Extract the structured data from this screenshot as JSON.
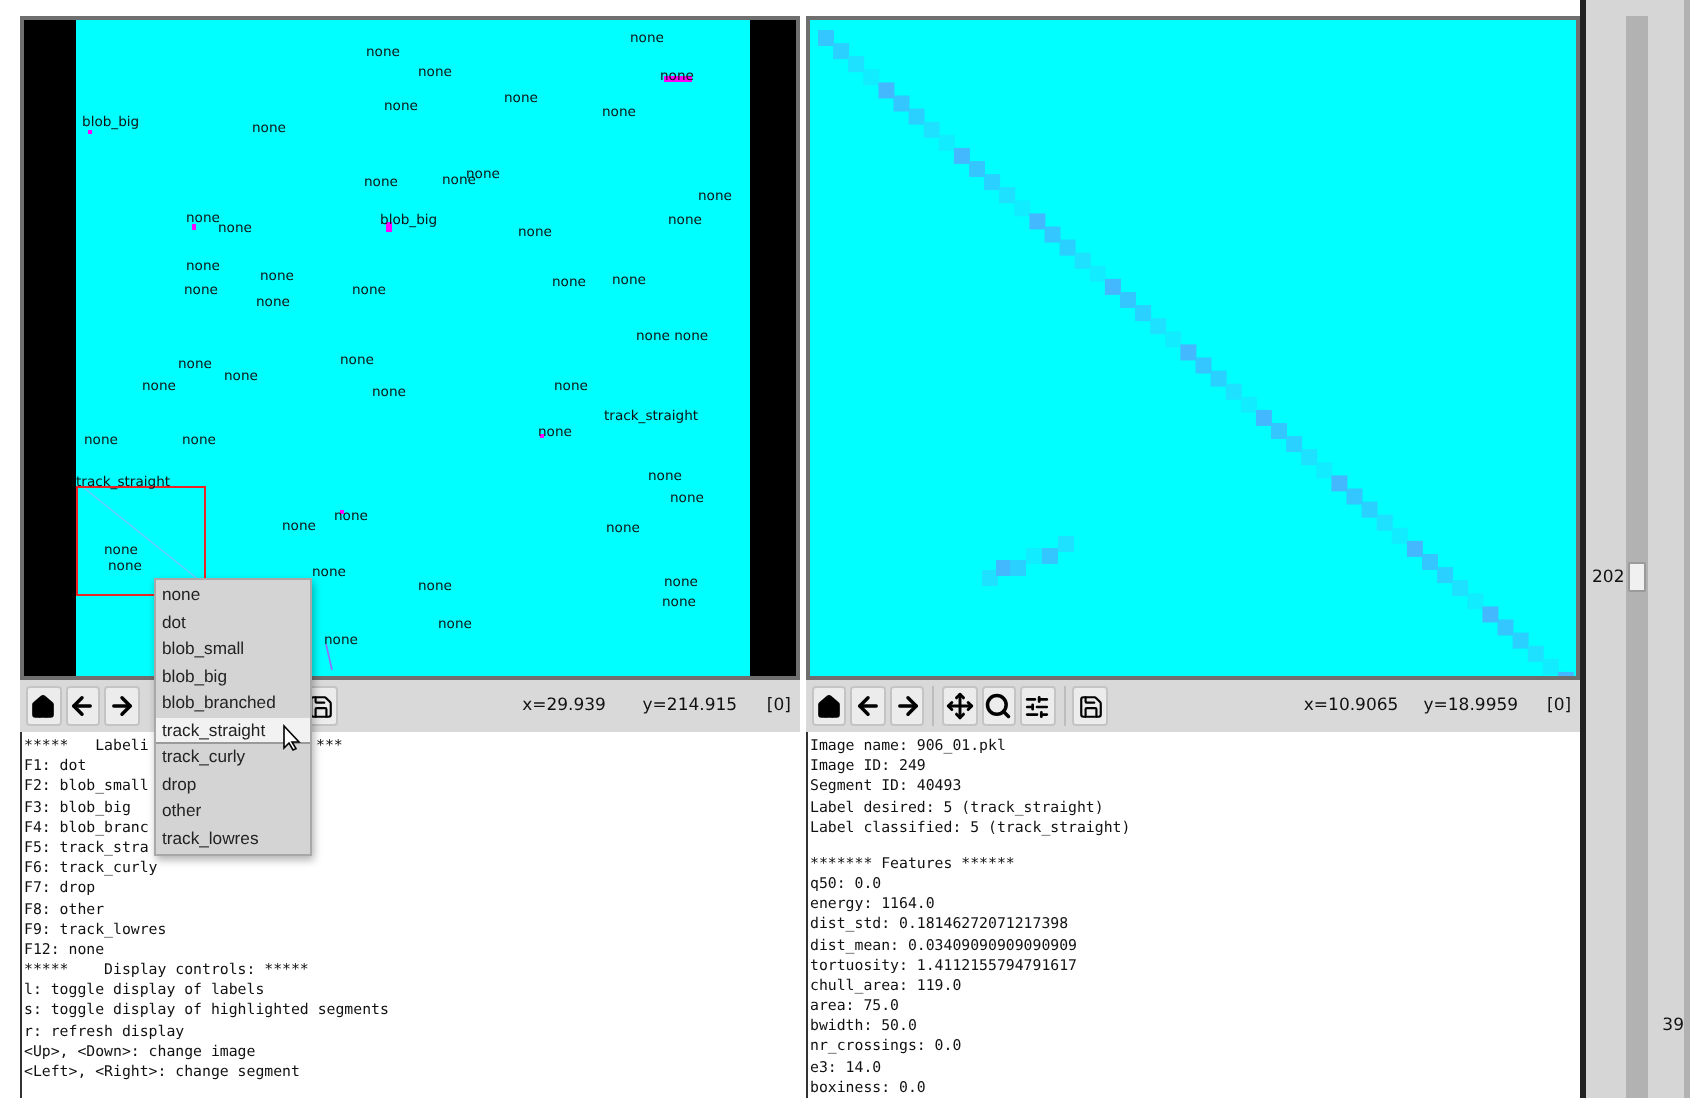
{
  "left_panel": {
    "labels": [
      {
        "text": "none"
      },
      {
        "text": "none"
      },
      {
        "text": "none"
      },
      {
        "text": "none"
      },
      {
        "text": "none"
      },
      {
        "text": "none"
      },
      {
        "text": "none"
      },
      {
        "text": "blob_big"
      },
      {
        "text": "none"
      },
      {
        "text": "none"
      },
      {
        "text": "none"
      },
      {
        "text": "none"
      },
      {
        "text": "none"
      },
      {
        "text": "none"
      },
      {
        "text": "none"
      },
      {
        "text": "blob_big"
      },
      {
        "text": "none"
      },
      {
        "text": "none"
      },
      {
        "text": "none"
      },
      {
        "text": "none"
      },
      {
        "text": "none"
      },
      {
        "text": "none"
      },
      {
        "text": "none"
      },
      {
        "text": "none"
      },
      {
        "text": "none"
      },
      {
        "text": "none none"
      },
      {
        "text": "none"
      },
      {
        "text": "none"
      },
      {
        "text": "none"
      },
      {
        "text": "none"
      },
      {
        "text": "none"
      },
      {
        "text": "none"
      },
      {
        "text": "track_straight"
      },
      {
        "text": "none"
      },
      {
        "text": "none"
      },
      {
        "text": "none"
      },
      {
        "text": "track_straight"
      },
      {
        "text": "none"
      },
      {
        "text": "none"
      },
      {
        "text": "none"
      },
      {
        "text": "none"
      },
      {
        "text": "none"
      },
      {
        "text": "none"
      },
      {
        "text": "none"
      },
      {
        "text": "none"
      },
      {
        "text": "none"
      },
      {
        "text": "none"
      },
      {
        "text": "none"
      },
      {
        "text": "none"
      },
      {
        "text": "none"
      }
    ],
    "menu": {
      "items": [
        {
          "label": "none",
          "selected": false
        },
        {
          "label": "dot",
          "selected": false
        },
        {
          "label": "blob_small",
          "selected": false
        },
        {
          "label": "blob_big",
          "selected": false
        },
        {
          "label": "blob_branched",
          "selected": false
        },
        {
          "label": "track_straight",
          "selected": true
        },
        {
          "label": "track_curly",
          "selected": false
        },
        {
          "label": "drop",
          "selected": false
        },
        {
          "label": "other",
          "selected": false
        },
        {
          "label": "track_lowres",
          "selected": false
        }
      ]
    },
    "toolbar": {
      "x_reading": "x=29.939",
      "y_reading": "y=214.915",
      "index": "[0]"
    },
    "text_lines": [
      "*****   Labeli",
      "F1: dot",
      "F2: blob_small",
      "F3: blob_big",
      "F4: blob_branc",
      "F5: track_stra",
      "F6: track_curly",
      "F7: drop",
      "F8: other",
      "F9: track_lowres",
      "F12: none",
      "*****    Display controls: *****",
      "l: toggle display of labels",
      "s: toggle display of highlighted segments",
      "r: refresh display",
      "<Up>, <Down>: change image",
      "<Left>, <Right>: change segment"
    ],
    "covered_tail": "***"
  },
  "right_panel": {
    "toolbar": {
      "x_reading": "x=10.9065",
      "y_reading": "y=18.9959",
      "index": "[0]"
    },
    "info_lines": [
      "Image name: 906_01.pkl",
      "Image ID: 249",
      "Segment ID: 40493",
      "Label desired: 5 (track_straight)",
      "Label classified: 5 (track_straight)"
    ],
    "feature_lines": [
      "******* Features ******",
      "q50: 0.0",
      "energy: 1164.0",
      "dist_std: 0.18146272071217398",
      "dist_mean: 0.03409090909090909",
      "tortuosity: 1.4112155794791617",
      "chull_area: 119.0",
      "area: 75.0",
      "bwidth: 50.0",
      "nr_crossings: 0.0",
      "e3: 14.0",
      "boxiness: 0.0"
    ]
  },
  "sliders": [
    {
      "reading": "202",
      "level": 0.48
    },
    {
      "reading": "39"
    }
  ]
}
